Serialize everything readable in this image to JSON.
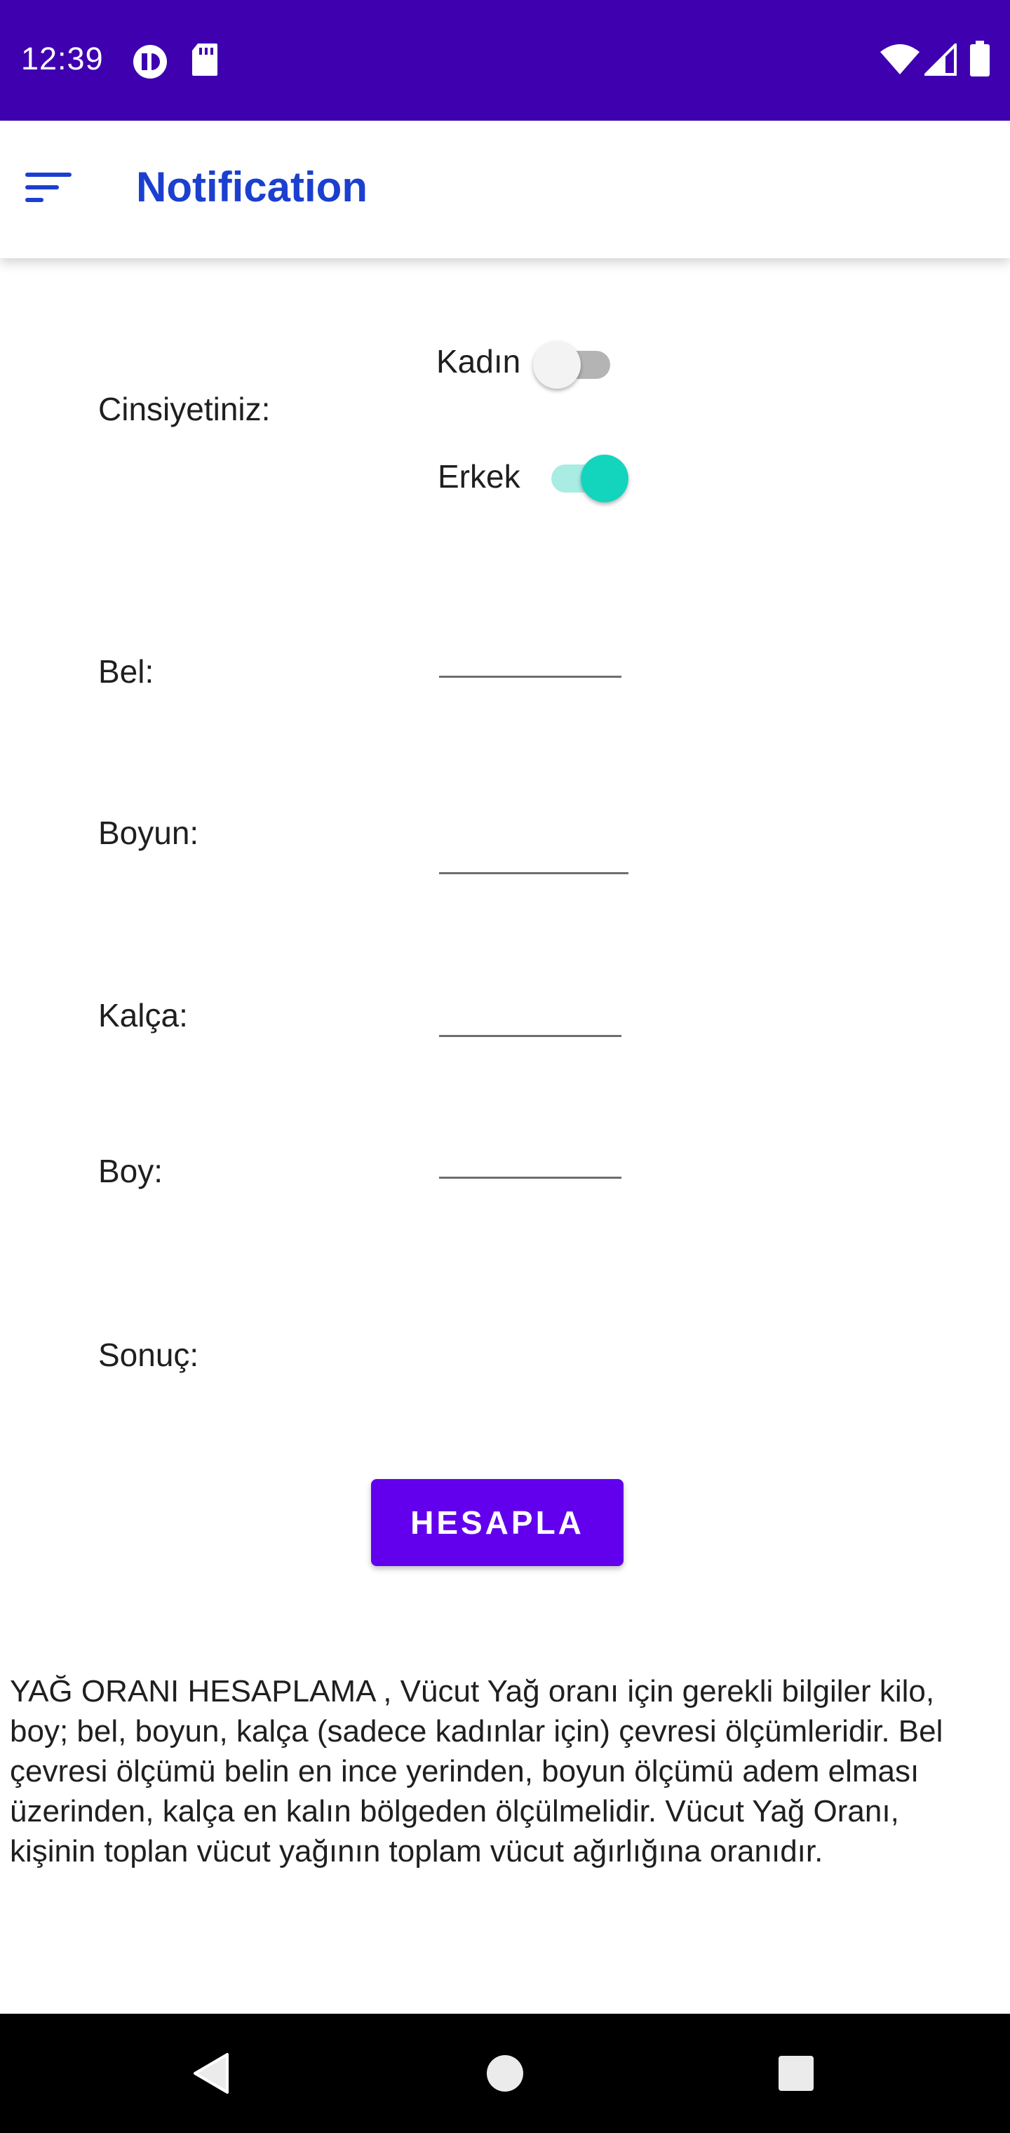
{
  "status_bar": {
    "time": "12:39",
    "icons": [
      "app-notification-icon",
      "sd-card-icon",
      "wifi-icon",
      "cell-signal-icon",
      "battery-icon"
    ],
    "background": "#3f00b0"
  },
  "app_bar": {
    "title": "Notification",
    "menu_icon": "sort-menu-icon",
    "title_color": "#1b3fcf"
  },
  "form": {
    "gender_label": "Cinsiyetiniz:",
    "female_label": "Kadın",
    "female_on": false,
    "male_label": "Erkek",
    "male_on": true,
    "waist_label": "Bel:",
    "waist_value": "",
    "neck_label": "Boyun:",
    "neck_value": "",
    "hip_label": "Kalça:",
    "hip_value": "",
    "height_label": "Boy:",
    "height_value": "",
    "result_label": "Sonuç:",
    "result_value": "",
    "calculate_button": "HESAPLA",
    "accent_color": "#6200ee",
    "switch_on_color": "#13d5bd"
  },
  "info_text": "YAĞ ORANI HESAPLAMA , Vücut Yağ oranı için gerekli bilgiler kilo, boy; bel, boyun, kalça (sadece kadınlar için) çevresi ölçümleridir. Bel çevresi ölçümü belin en ince yerinden, boyun ölçümü adem elması üzerinden, kalça en kalın bölgeden ölçülmelidir. Vücut Yağ Oranı, kişinin toplan vücut yağının toplam vücut ağırlığına oranıdır.",
  "nav_bar": {
    "icons": [
      "back-icon",
      "home-icon",
      "recents-icon"
    ]
  }
}
